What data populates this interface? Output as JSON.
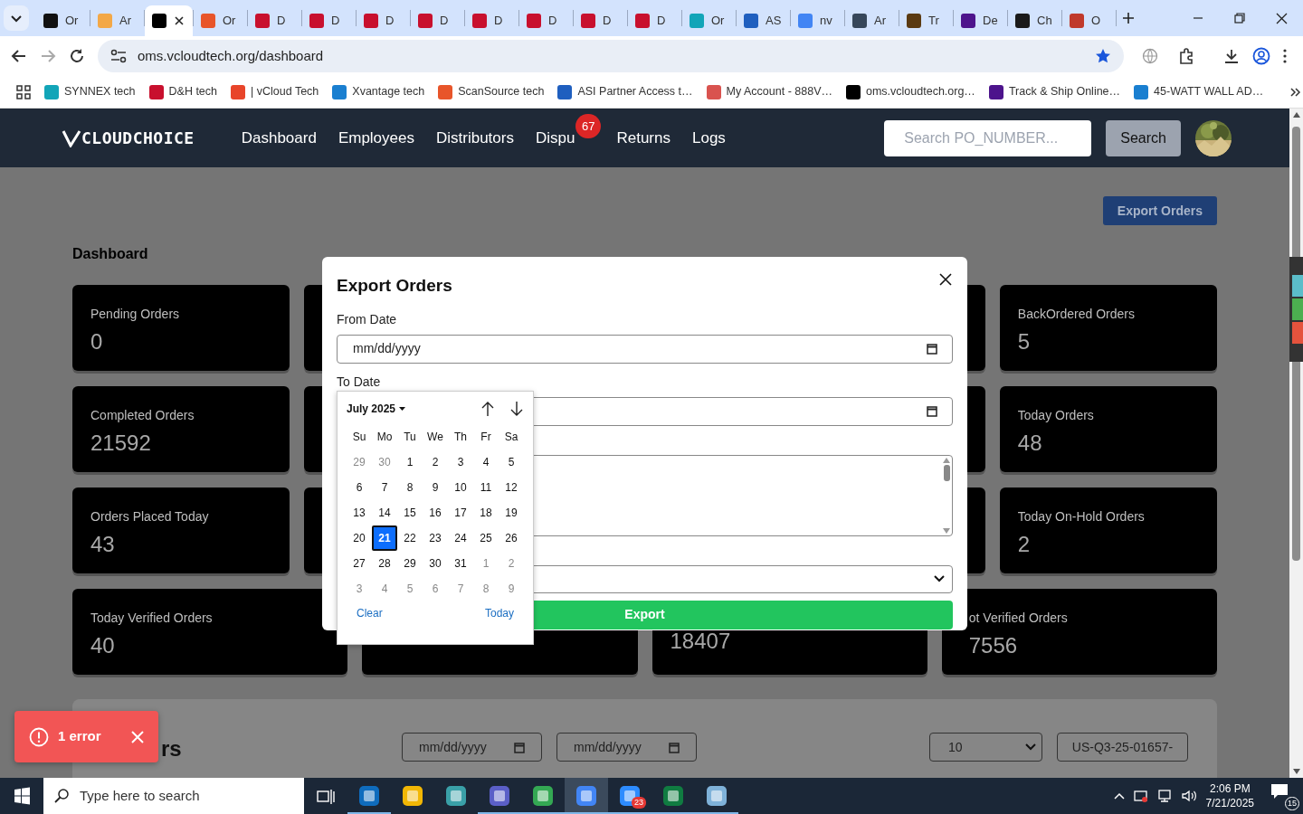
{
  "browser": {
    "tabs": [
      {
        "title": "Or",
        "color": "#111111",
        "selected": false
      },
      {
        "title": "Ar",
        "color": "#f3a847",
        "selected": false
      },
      {
        "color": "#000000",
        "selected": true
      },
      {
        "title": "Or",
        "color": "#e8552a",
        "selected": false
      },
      {
        "title": "D",
        "color": "#c8102e",
        "selected": false
      },
      {
        "title": "D",
        "color": "#c8102e",
        "selected": false
      },
      {
        "title": "D",
        "color": "#c8102e",
        "selected": false
      },
      {
        "title": "D",
        "color": "#c8102e",
        "selected": false
      },
      {
        "title": "D",
        "color": "#c8102e",
        "selected": false
      },
      {
        "title": "D",
        "color": "#c8102e",
        "selected": false
      },
      {
        "title": "D",
        "color": "#c8102e",
        "selected": false
      },
      {
        "title": "D",
        "color": "#c8102e",
        "selected": false
      },
      {
        "title": "Or",
        "color": "#12a5b8",
        "selected": false
      },
      {
        "title": "AS",
        "color": "#1f5fbf",
        "selected": false
      },
      {
        "title": "nv",
        "color": "#4285f4",
        "selected": false
      },
      {
        "title": "Ar",
        "color": "#37475a",
        "selected": false
      },
      {
        "title": "Tr",
        "color": "#5a3a12",
        "selected": false
      },
      {
        "title": "De",
        "color": "#4d148c",
        "selected": false
      },
      {
        "title": "Ch",
        "color": "#1a1a1a",
        "selected": false
      },
      {
        "title": "O",
        "color": "#c0392b",
        "selected": false
      }
    ],
    "url": "oms.vcloudtech.org/dashboard",
    "bookmarks": [
      {
        "label": "SYNNEX tech",
        "color": "#12a5b8"
      },
      {
        "label": "D&H tech",
        "color": "#c8102e"
      },
      {
        "label": "| vCloud Tech",
        "color": "#e8452a"
      },
      {
        "label": "Xvantage tech",
        "color": "#1a7fd0"
      },
      {
        "label": "ScanSource tech",
        "color": "#e8552a"
      },
      {
        "label": "ASI Partner Access t…",
        "color": "#1f5fbf"
      },
      {
        "label": "My Account - 888V…",
        "color": "#d9534f"
      },
      {
        "label": "oms.vcloudtech.org…",
        "color": "#000000"
      },
      {
        "label": "Track & Ship Online…",
        "color": "#4d148c"
      },
      {
        "label": "45-WATT WALL AD…",
        "color": "#1a7fd0"
      }
    ]
  },
  "navbar": {
    "logo": "CLOUDCHOICE",
    "links": [
      {
        "label": "Dashboard"
      },
      {
        "label": "Employees"
      },
      {
        "label": "Distributors"
      },
      {
        "label": "Dispu",
        "badge": "67"
      },
      {
        "label": "Returns"
      },
      {
        "label": "Logs"
      }
    ],
    "search": {
      "placeholder": "Search PO_NUMBER..."
    },
    "search_button": "Search"
  },
  "page": {
    "export_button": "Export Orders",
    "heading": "Dashboard",
    "card_rows": [
      {
        "kind": "narrow",
        "cards": [
          {
            "title": "Pending Orders",
            "value": "0"
          },
          {
            "kind": "covered"
          },
          {
            "kind": "covered"
          },
          {
            "title": "BackOrdered Orders",
            "value": "5"
          }
        ]
      },
      {
        "kind": "narrow",
        "cards": [
          {
            "title": "Completed Orders",
            "value": "21592"
          },
          {
            "kind": "covered"
          },
          {
            "kind": "covered"
          },
          {
            "title": "Today Orders",
            "value": "48"
          }
        ]
      },
      {
        "kind": "narrow",
        "cards": [
          {
            "title": "Orders Placed Today",
            "value": "43"
          },
          {
            "kind": "covered"
          },
          {
            "kind": "covered"
          },
          {
            "title": "Today On-Hold Orders",
            "value": "2"
          }
        ]
      },
      {
        "kind": "wide",
        "cards": [
          {
            "title": "Today Verified Orders",
            "value": "40"
          },
          {
            "kind": "covered"
          },
          {
            "value": "18407"
          },
          {
            "title": "ot Verified Orders",
            "value": "7556"
          }
        ]
      }
    ],
    "orders_panel": {
      "heading": "rs",
      "from_date": {
        "placeholder": "mm/dd/yyyy"
      },
      "to_date": {
        "placeholder": "mm/dd/yyyy"
      },
      "page_size": "10",
      "po_filter": "US-Q3-25-01657-"
    }
  },
  "modal": {
    "title": "Export Orders",
    "fields": [
      {
        "label": "From Date",
        "placeholder": "mm/dd/yyyy"
      },
      {
        "label": "To Date"
      }
    ],
    "export_button": "Export"
  },
  "datepicker": {
    "month": "July 2025",
    "weekdays": [
      "Su",
      "Mo",
      "Tu",
      "We",
      "Th",
      "Fr",
      "Sa"
    ],
    "days": [
      {
        "d": "29",
        "muted": true,
        "selected": false
      },
      {
        "d": "30",
        "muted": true,
        "selected": false
      },
      {
        "d": "1",
        "muted": false,
        "selected": false
      },
      {
        "d": "2",
        "muted": false,
        "selected": false
      },
      {
        "d": "3",
        "muted": false,
        "selected": false
      },
      {
        "d": "4",
        "muted": false,
        "selected": false
      },
      {
        "d": "5",
        "muted": false,
        "selected": false
      },
      {
        "d": "6",
        "muted": false,
        "selected": false
      },
      {
        "d": "7",
        "muted": false,
        "selected": false
      },
      {
        "d": "8",
        "muted": false,
        "selected": false
      },
      {
        "d": "9",
        "muted": false,
        "selected": false
      },
      {
        "d": "10",
        "muted": false,
        "selected": false
      },
      {
        "d": "11",
        "muted": false,
        "selected": false
      },
      {
        "d": "12",
        "muted": false,
        "selected": false
      },
      {
        "d": "13",
        "muted": false,
        "selected": false
      },
      {
        "d": "14",
        "muted": false,
        "selected": false
      },
      {
        "d": "15",
        "muted": false,
        "selected": false
      },
      {
        "d": "16",
        "muted": false,
        "selected": false
      },
      {
        "d": "17",
        "muted": false,
        "selected": false
      },
      {
        "d": "18",
        "muted": false,
        "selected": false
      },
      {
        "d": "19",
        "muted": false,
        "selected": false
      },
      {
        "d": "20",
        "muted": false,
        "selected": false
      },
      {
        "d": "21",
        "muted": false,
        "selected": true
      },
      {
        "d": "22",
        "muted": false,
        "selected": false
      },
      {
        "d": "23",
        "muted": false,
        "selected": false
      },
      {
        "d": "24",
        "muted": false,
        "selected": false
      },
      {
        "d": "25",
        "muted": false,
        "selected": false
      },
      {
        "d": "26",
        "muted": false,
        "selected": false
      },
      {
        "d": "27",
        "muted": false,
        "selected": false
      },
      {
        "d": "28",
        "muted": false,
        "selected": false
      },
      {
        "d": "29",
        "muted": false,
        "selected": false
      },
      {
        "d": "30",
        "muted": false,
        "selected": false
      },
      {
        "d": "31",
        "muted": false,
        "selected": false
      },
      {
        "d": "1",
        "muted": true,
        "selected": false
      },
      {
        "d": "2",
        "muted": true,
        "selected": false
      },
      {
        "d": "3",
        "muted": true,
        "selected": false
      },
      {
        "d": "4",
        "muted": true,
        "selected": false
      },
      {
        "d": "5",
        "muted": true,
        "selected": false
      },
      {
        "d": "6",
        "muted": true,
        "selected": false
      },
      {
        "d": "7",
        "muted": true,
        "selected": false
      },
      {
        "d": "8",
        "muted": true,
        "selected": false
      },
      {
        "d": "9",
        "muted": true,
        "selected": false
      }
    ],
    "clear": "Clear",
    "today": "Today"
  },
  "toast": {
    "message": "1 error"
  },
  "taskbar": {
    "search": {
      "placeholder": "Type here to search"
    },
    "apps": [
      {
        "color": "#0f6cbd",
        "running": true,
        "active": false
      },
      {
        "color": "#f2b705",
        "running": false,
        "active": false
      },
      {
        "color": "#3aa0a8",
        "running": false,
        "active": false
      },
      {
        "color": "#5b5fc7",
        "running": true,
        "active": false
      },
      {
        "color": "#34a853",
        "running": true,
        "active": false
      },
      {
        "color": "#4285f4",
        "running": true,
        "active": true
      },
      {
        "color": "#2d8cff",
        "running": true,
        "active": false,
        "badge": "23"
      },
      {
        "color": "#107c41",
        "running": true,
        "active": false
      },
      {
        "color": "#7fb2d9",
        "running": true,
        "active": false
      }
    ],
    "time": "2:06 PM",
    "date": "7/21/2025",
    "notifications": "15"
  }
}
